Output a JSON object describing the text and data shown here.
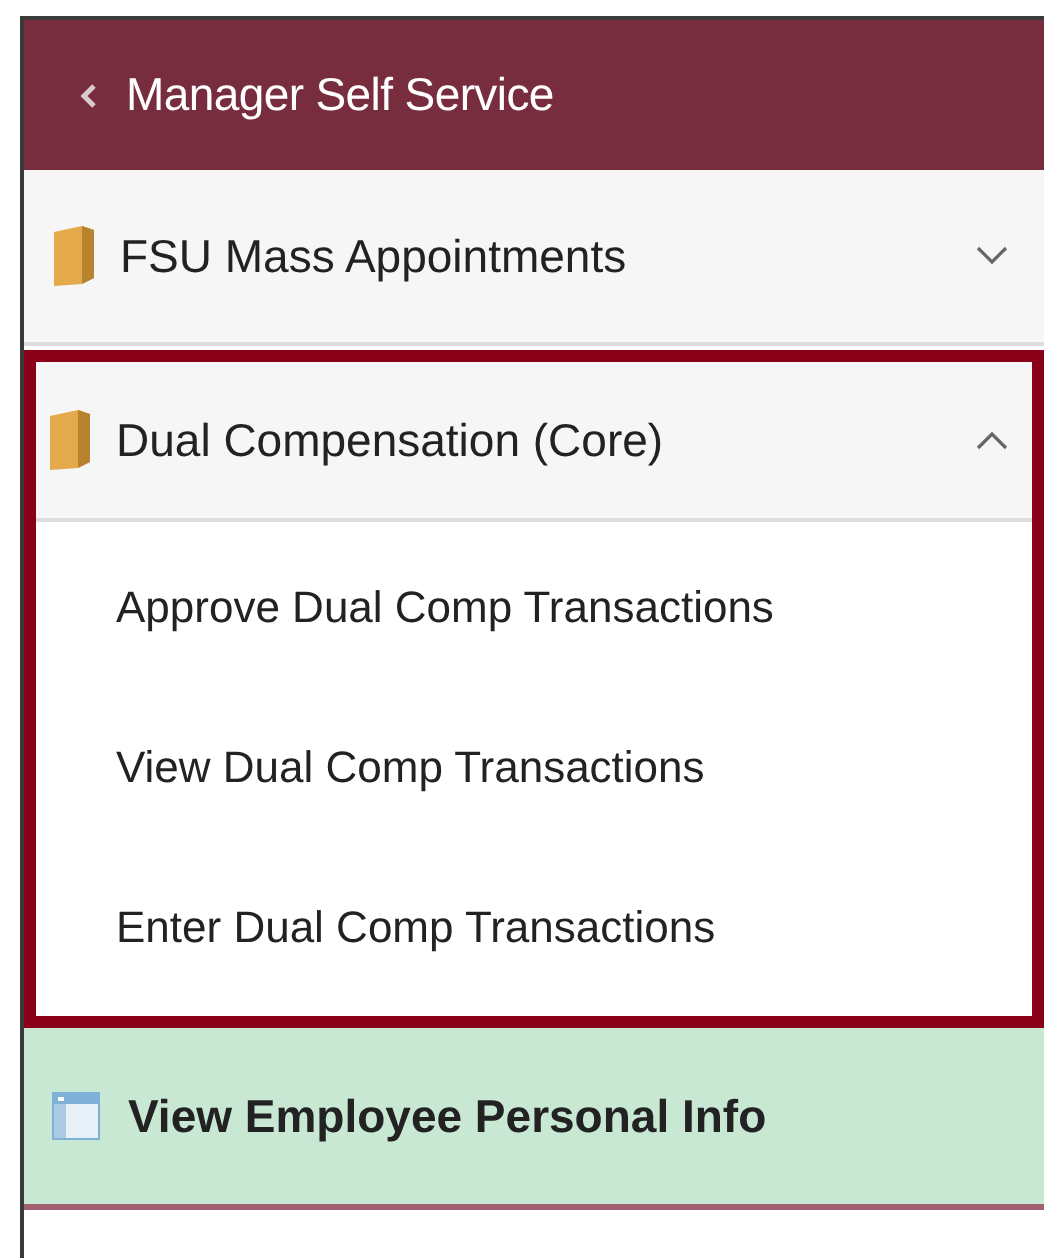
{
  "header": {
    "title": "Manager Self Service"
  },
  "items": [
    {
      "kind": "folder",
      "label": "FSU Mass Appointments",
      "expanded": false,
      "highlighted": false
    },
    {
      "kind": "folder",
      "label": "Dual Compensation (Core)",
      "expanded": true,
      "highlighted": true,
      "children": [
        {
          "label": "Approve Dual Comp Transactions"
        },
        {
          "label": "View Dual Comp Transactions"
        },
        {
          "label": "Enter Dual Comp Transactions"
        }
      ]
    },
    {
      "kind": "page",
      "label": "View Employee Personal Info",
      "selected": true
    }
  ]
}
